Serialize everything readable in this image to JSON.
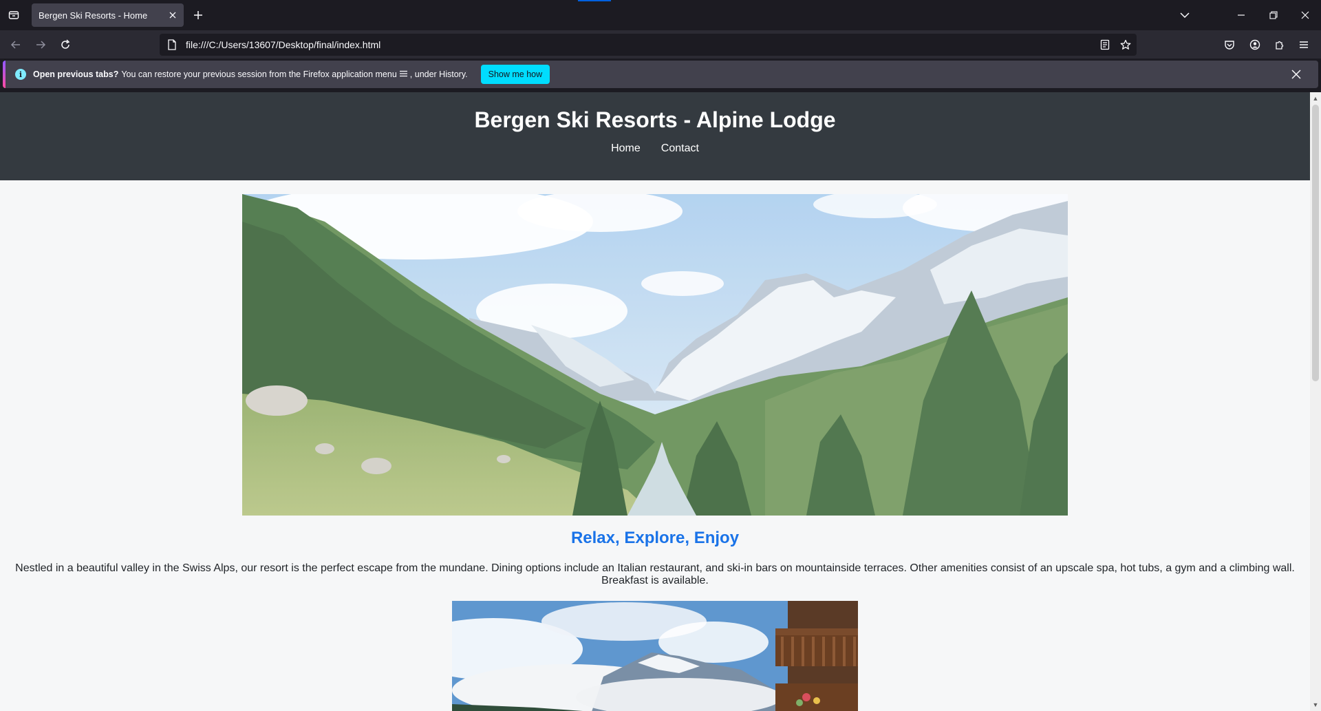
{
  "browser": {
    "tab_title": "Bergen Ski Resorts - Home",
    "url": "file:///C:/Users/13607/Desktop/final/index.html"
  },
  "notification": {
    "bold_text": "Open previous tabs?",
    "text_before_icon": "You can restore your previous session from the Firefox application menu",
    "text_after_icon": ", under History.",
    "button_label": "Show me how"
  },
  "site": {
    "title": "Bergen Ski Resorts - Alpine Lodge",
    "nav": [
      {
        "label": "Home"
      },
      {
        "label": "Contact"
      }
    ],
    "section_heading": "Relax, Explore, Enjoy",
    "section_text": "Nestled in a beautiful valley in the Swiss Alps, our resort is the perfect escape from the mundane. Dining options include an Italian restaurant, and ski-in bars on mountainside terraces. Other amenities consist of an upscale spa, hot tubs, a gym and a climbing wall. Breakfast is available."
  },
  "colors": {
    "header_bg": "#343a40",
    "heading_accent": "#1a73e8",
    "page_bg": "#f6f7f8",
    "notif_button": "#00ddff"
  }
}
